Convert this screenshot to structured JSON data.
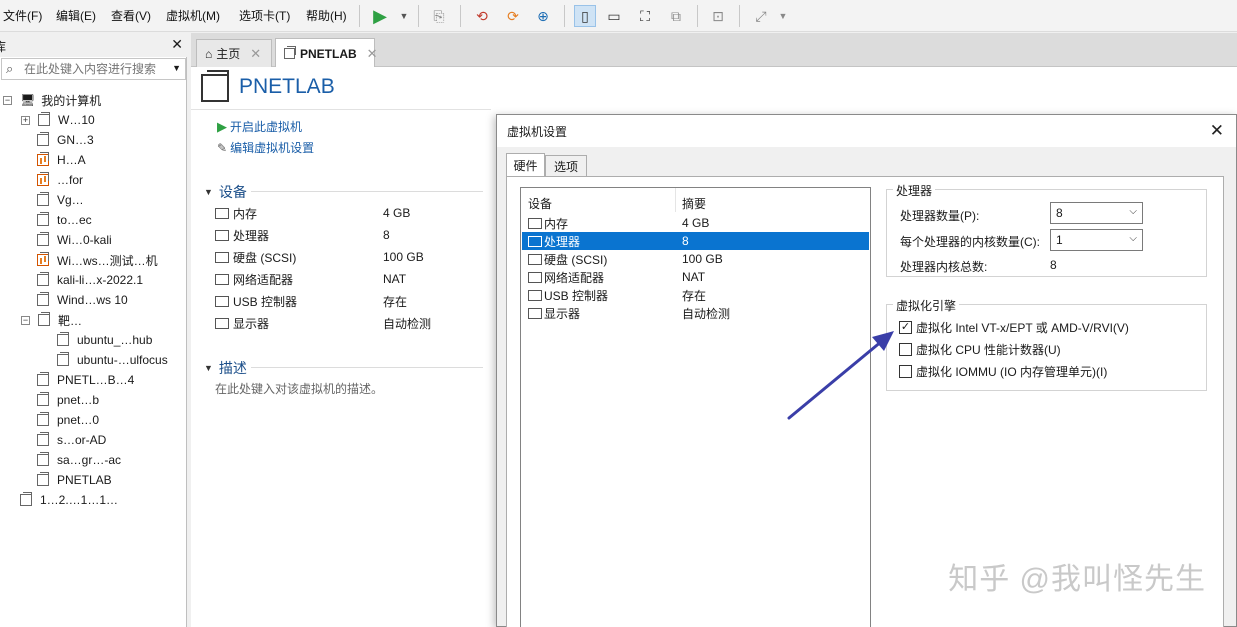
{
  "menu": [
    "文件(F)",
    "编辑(E)",
    "查看(V)",
    "虚拟机(M)",
    "选项卡(T)",
    "帮助(H)"
  ],
  "library": {
    "header_fragment": "库",
    "search_placeholder": "在此处键入内容进行搜索",
    "root_label": "我的计算机",
    "items": [
      {
        "label": "W…10",
        "indent": 1,
        "expandable": true
      },
      {
        "label": "GN…3",
        "indent": 1
      },
      {
        "label": "H…A",
        "indent": 1,
        "running": true
      },
      {
        "label": "…for",
        "indent": 1,
        "running": true
      },
      {
        "label": "Vg…",
        "indent": 1
      },
      {
        "label": "to…ec",
        "indent": 1
      },
      {
        "label": "Wi…0-kali",
        "indent": 1
      },
      {
        "label": "Wi…ws…测试…机",
        "indent": 1,
        "running": true
      },
      {
        "label": "kali-li…x-2022.1",
        "indent": 1
      },
      {
        "label": "Wind…ws 10",
        "indent": 1
      },
      {
        "label": "靶…",
        "indent": 1,
        "expandable": true,
        "folder": true
      },
      {
        "label": "ubuntu_…hub",
        "indent": 2
      },
      {
        "label": "ubuntu-…ulfocus",
        "indent": 2
      },
      {
        "label": "PNETL…B…4",
        "indent": 1
      },
      {
        "label": "pnet…b",
        "indent": 1
      },
      {
        "label": "pnet…0",
        "indent": 1
      },
      {
        "label": "s…or-AD",
        "indent": 1
      },
      {
        "label": "sa…gr…-ac",
        "indent": 1
      },
      {
        "label": "PNETLAB",
        "indent": 1
      },
      {
        "label": "1…2.…1…1…",
        "indent": 0
      }
    ]
  },
  "tabs": [
    {
      "label": "主页",
      "active": false
    },
    {
      "label": "PNETLAB",
      "active": true
    }
  ],
  "vm": {
    "title": "PNETLAB",
    "actions": [
      "开启此虚拟机",
      "编辑虚拟机设置"
    ],
    "devices_title": "设备",
    "devices": [
      {
        "name": "内存",
        "value": "4 GB"
      },
      {
        "name": "处理器",
        "value": "8"
      },
      {
        "name": "硬盘 (SCSI)",
        "value": "100 GB"
      },
      {
        "name": "网络适配器",
        "value": "NAT"
      },
      {
        "name": "USB 控制器",
        "value": "存在"
      },
      {
        "name": "显示器",
        "value": "自动检测"
      }
    ],
    "desc_title": "描述",
    "desc_placeholder": "在此处键入对该虚拟机的描述。"
  },
  "dialog": {
    "title": "虚拟机设置",
    "tabs": [
      "硬件",
      "选项"
    ],
    "list_headers": [
      "设备",
      "摘要"
    ],
    "list_selected_index": 1,
    "processor_group": {
      "title": "处理器",
      "count_label": "处理器数量(P):",
      "count_value": "8",
      "cores_label": "每个处理器的内核数量(C):",
      "cores_value": "1",
      "total_label": "处理器内核总数:",
      "total_value": "8"
    },
    "virt_group": {
      "title": "虚拟化引擎",
      "options": [
        {
          "label": "虚拟化 Intel VT-x/EPT 或 AMD-V/RVI(V)",
          "checked": true
        },
        {
          "label": "虚拟化 CPU 性能计数器(U)",
          "checked": false
        },
        {
          "label": "虚拟化 IOMMU (IO 内存管理单元)(I)",
          "checked": false
        }
      ]
    }
  },
  "watermark": "知乎 @我叫怪先生",
  "colors": {
    "accent": "#0a74d0",
    "link": "#1a5ea8",
    "arrow": "#3a3ea8",
    "play": "#2ea043"
  }
}
